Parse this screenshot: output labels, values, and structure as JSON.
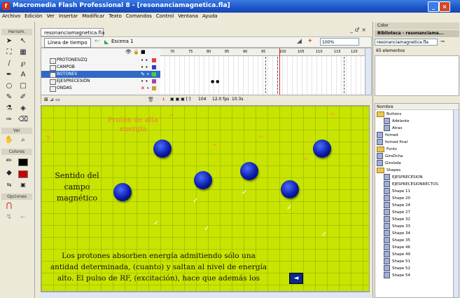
{
  "window": {
    "title": "Macromedia Flash Professional 8 - [resonanciamagnetica.fla]",
    "controls": [
      "_",
      "□",
      "×"
    ]
  },
  "menu": [
    "Archivo",
    "Edición",
    "Ver",
    "Insertar",
    "Modificar",
    "Texto",
    "Comandos",
    "Control",
    "Ventana",
    "Ayuda"
  ],
  "tools": {
    "section_tools": "Herram.",
    "section_view": "Ver",
    "section_colors": "Colores",
    "section_options": "Opciones"
  },
  "document": {
    "tab": "resonanciamagnetica.fla",
    "timeline_button": "Línea de tiempo",
    "scene": "Escena 1",
    "zoom": "100%",
    "controls": "_ ♂ ×"
  },
  "timeline": {
    "layers": [
      "PROTONESIZQ",
      "CAMPOB",
      "BOTONES",
      "EJESPRECESIÓN",
      "ONDAS"
    ],
    "ruler": [
      "70",
      "75",
      "80",
      "85",
      "90",
      "95",
      "100",
      "105",
      "110",
      "115",
      "120"
    ],
    "status": {
      "frame": "104",
      "fps": "12.0 fps",
      "time": "10.3s"
    }
  },
  "stage": {
    "title_line1": "Protón de alta",
    "title_line2": "energía",
    "sentido_line1": "Sentido del",
    "sentido_line2": "campo",
    "sentido_line3": "magnético",
    "explain_line1": "Los protones absorben energía admitiendo sólo una",
    "explain_line2": "antidad determinada, (cuanto) y saltan al nivel de energía",
    "explain_line3": "alto. El pulso de RF, (excitación), hace que además los",
    "nav_button": "◄"
  },
  "library": {
    "color_panel": "Color",
    "title": "Biblioteca - resonanciama...",
    "selector": "resonanciamagnetica.fla",
    "count": "65 elementos",
    "column": "Nombre",
    "items": [
      "Buttons",
      "Adelante",
      "Atras",
      "fsimed",
      "fsimed final",
      "Fonts",
      "GiroDcha",
      "GiroIzda",
      "Shapes",
      "EJESPRECESION",
      "EJESPRECESIONRECTOS",
      "Shape 11",
      "Shape 20",
      "Shape 24",
      "Shape 27",
      "Shape 32",
      "Shape 33",
      "Shape 34",
      "Shape 35",
      "Shape 46",
      "Shape 49",
      "Shape 51",
      "Shape 52",
      "Shape 54"
    ]
  }
}
